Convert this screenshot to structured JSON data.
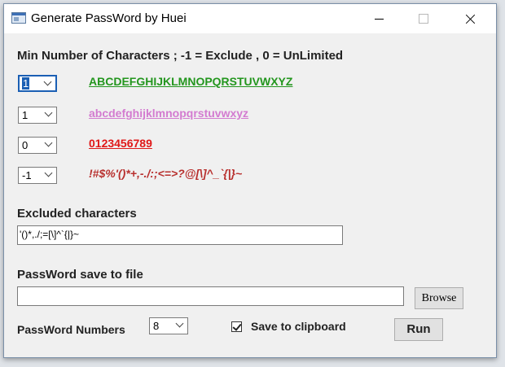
{
  "window": {
    "title": "Generate PassWord by Huei"
  },
  "min_chars": {
    "label": "Min Number of Characters   ;   -1 = Exclude   , 0 = UnLimited",
    "rows": [
      {
        "value": "1",
        "charset": "ABCDEFGHIJKLMNOPQRSTUVWXYZ"
      },
      {
        "value": "1",
        "charset": "abcdefghijklmnopqrstuvwxyz"
      },
      {
        "value": "0",
        "charset": "0123456789"
      },
      {
        "value": "-1",
        "charset": "!#$%'()*+,-./:;<=>?@[\\]^_`{|}~"
      }
    ]
  },
  "excluded": {
    "label": "Excluded characters",
    "value": "'()*,./;=[\\]^`{|}~"
  },
  "save_file": {
    "label": "PassWord save to file",
    "value": "",
    "browse_label": "Browse"
  },
  "count": {
    "label": "PassWord Numbers",
    "value": "8"
  },
  "clipboard": {
    "label": "Save to clipboard",
    "checked": true
  },
  "run": {
    "label": "Run"
  }
}
